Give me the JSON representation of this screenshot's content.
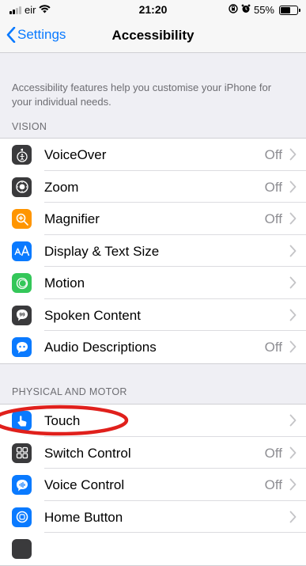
{
  "status_bar": {
    "carrier": "eir",
    "time": "21:20",
    "battery": "55%"
  },
  "nav": {
    "back_label": "Settings",
    "title": "Accessibility"
  },
  "description": "Accessibility features help you customise your iPhone for your individual needs.",
  "sections": {
    "vision": {
      "header": "VISION",
      "items": [
        {
          "label": "VoiceOver",
          "value": "Off",
          "icon": "voiceover-icon",
          "color": "#3a3a3c"
        },
        {
          "label": "Zoom",
          "value": "Off",
          "icon": "zoom-icon",
          "color": "#3a3a3c"
        },
        {
          "label": "Magnifier",
          "value": "Off",
          "icon": "magnifier-icon",
          "color": "#ff9500"
        },
        {
          "label": "Display & Text Size",
          "value": "",
          "icon": "display-text-icon",
          "color": "#0a7aff"
        },
        {
          "label": "Motion",
          "value": "",
          "icon": "motion-icon",
          "color": "#34c759"
        },
        {
          "label": "Spoken Content",
          "value": "",
          "icon": "spoken-content-icon",
          "color": "#3a3a3c"
        },
        {
          "label": "Audio Descriptions",
          "value": "Off",
          "icon": "audio-descriptions-icon",
          "color": "#0a7aff"
        }
      ]
    },
    "physical": {
      "header": "PHYSICAL AND MOTOR",
      "items": [
        {
          "label": "Touch",
          "value": "",
          "icon": "touch-icon",
          "color": "#0a7aff"
        },
        {
          "label": "Switch Control",
          "value": "Off",
          "icon": "switch-control-icon",
          "color": "#3a3a3c"
        },
        {
          "label": "Voice Control",
          "value": "Off",
          "icon": "voice-control-icon",
          "color": "#0a7aff"
        },
        {
          "label": "Home Button",
          "value": "",
          "icon": "home-button-icon",
          "color": "#0a7aff"
        }
      ]
    }
  },
  "annotation": {
    "color": "#e0201c"
  }
}
